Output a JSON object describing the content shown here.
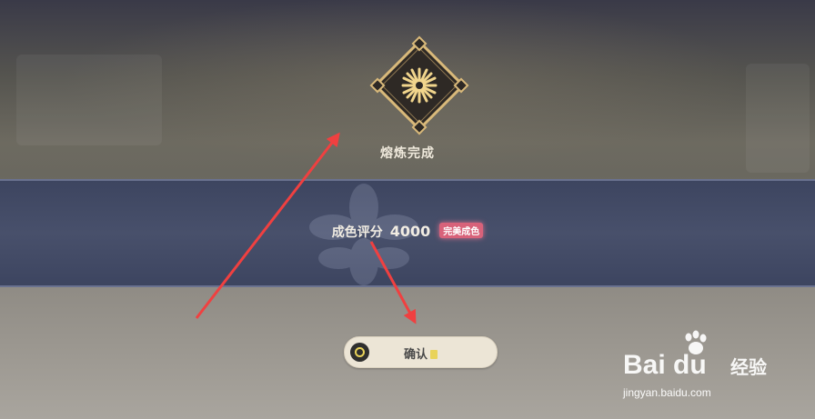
{
  "result": {
    "title": "熔炼完成",
    "score_label": "成色评分",
    "score_value": "4000",
    "badge": "完美成色"
  },
  "confirm_button": {
    "label": "确认",
    "icon": "key-prompt-icon"
  },
  "watermark": {
    "logo_text": "Bai du",
    "cn_text": "经验",
    "url": "jingyan.baidu.com"
  },
  "annotations": {
    "arrow_color": "#f04040"
  },
  "colors": {
    "band": "#48506b",
    "button_bg": "#ece5d6",
    "badge_bg": "#d8627a",
    "emblem_gold": "#d9b97a"
  }
}
